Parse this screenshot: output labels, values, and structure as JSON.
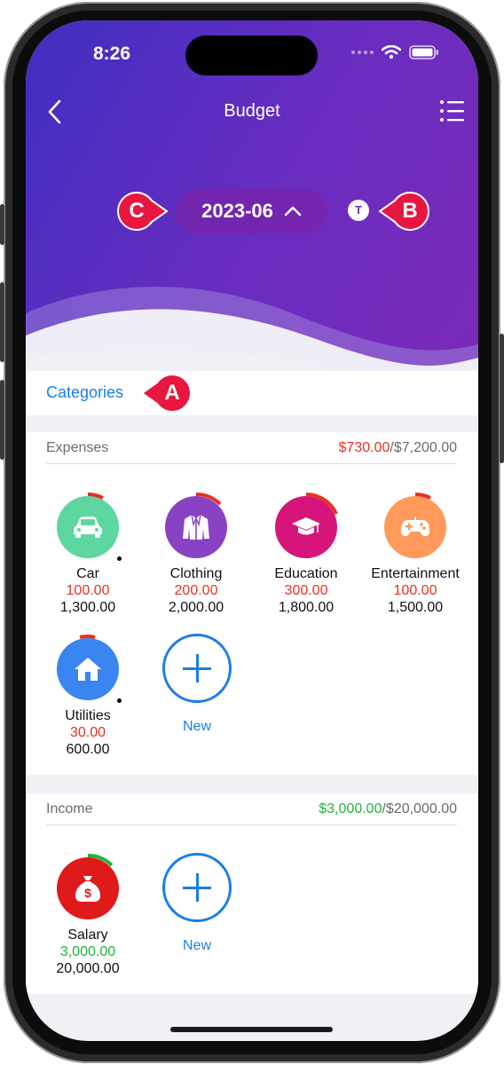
{
  "status_bar": {
    "time": "8:26"
  },
  "nav": {
    "title": "Budget"
  },
  "period": {
    "month": "2023-06",
    "t_badge": "T"
  },
  "callouts": {
    "a": "A",
    "b": "B",
    "c": "C"
  },
  "categories_label": "Categories",
  "expenses": {
    "title": "Expenses",
    "spent_total": "$730.00",
    "budget_total": "/$7,200.00",
    "items": [
      {
        "name": "Car",
        "spent": "100.00",
        "budget": "1,300.00",
        "color": "#5dd6a0",
        "icon": "car-icon"
      },
      {
        "name": "Clothing",
        "spent": "200.00",
        "budget": "2,000.00",
        "color": "#8a42c4",
        "icon": "jacket-icon"
      },
      {
        "name": "Education",
        "spent": "300.00",
        "budget": "1,800.00",
        "color": "#d6147a",
        "icon": "graduation-cap-icon"
      },
      {
        "name": "Entertainment",
        "spent": "100.00",
        "budget": "1,500.00",
        "color": "#ff9a5a",
        "icon": "gamepad-icon"
      },
      {
        "name": "Utilities",
        "spent": "30.00",
        "budget": "600.00",
        "color": "#3a86f0",
        "icon": "house-icon"
      }
    ],
    "new_label": "New"
  },
  "income": {
    "title": "Income",
    "received_total": "$3,000.00",
    "budget_total": "/$20,000.00",
    "items": [
      {
        "name": "Salary",
        "received": "3,000.00",
        "budget": "20,000.00",
        "color": "#e01a1a",
        "icon": "money-bag-icon"
      }
    ],
    "new_label": "New"
  },
  "colors": {
    "accent": "#1a7ee8",
    "expense": "#e8311f",
    "income": "#21b53b",
    "callout": "#e8173f"
  }
}
